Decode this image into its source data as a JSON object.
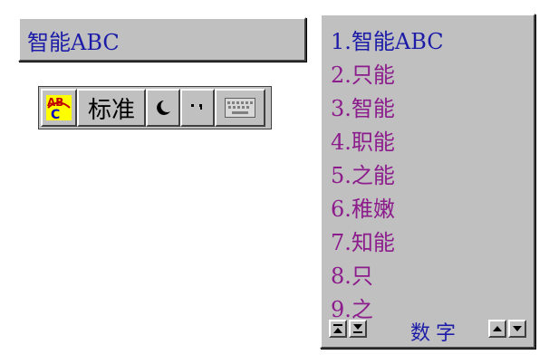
{
  "composition": {
    "text": "智能ABC"
  },
  "status_bar": {
    "mode_label": "标准",
    "icons": {
      "logo": "abc-logo-icon",
      "width": "half-width-moon-icon",
      "punct": "punctuation-icon",
      "keyboard": "soft-keyboard-icon"
    }
  },
  "candidates": {
    "items": [
      "1.智能ABC",
      "2.只能",
      "3.智能",
      "4.职能",
      "5.之能",
      "6.稚嫩",
      "7.知能",
      "8.只",
      "9.之"
    ],
    "footer_label": "数字"
  },
  "colors": {
    "face": "#c0c0c0",
    "first_candidate": "#1c1ca8",
    "candidate": "#8c1c8c"
  }
}
